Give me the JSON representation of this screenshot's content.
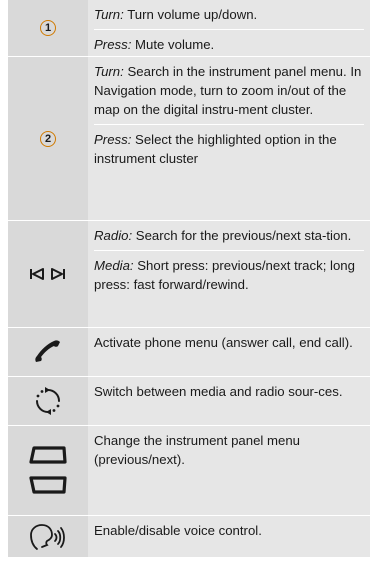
{
  "rows": [
    {
      "icon": "number-1-circle-icon",
      "badge": "1",
      "paras": [
        {
          "label": "Turn:",
          "text": " Turn volume up/down."
        },
        {
          "label": "Press:",
          "text": " Mute volume."
        }
      ]
    },
    {
      "icon": "number-2-circle-icon",
      "badge": "2",
      "paras": [
        {
          "label": "Turn:",
          "text": " Search in the instrument panel menu. In Navigation mode, turn to zoom in/out of the map on the digital instru-ment cluster."
        },
        {
          "label": "Press:",
          "text": " Select the highlighted option in the instrument cluster"
        }
      ]
    },
    {
      "icon": "previous-next-icon",
      "paras": [
        {
          "label": "Radio:",
          "text": " Search for the previous/next sta-tion."
        },
        {
          "label": "Media:",
          "text": " Short press: previous/next track; long press: fast forward/rewind."
        }
      ]
    },
    {
      "icon": "phone-icon",
      "paras": [
        {
          "label": "",
          "text": "Activate phone menu (answer call, end call)."
        }
      ]
    },
    {
      "icon": "source-switch-icon",
      "paras": [
        {
          "label": "",
          "text": "Switch between media and radio sour-ces."
        }
      ]
    },
    {
      "icon": "instrument-menu-icon",
      "paras": [
        {
          "label": "",
          "text": "Change the instrument panel menu (previous/next)."
        }
      ]
    },
    {
      "icon": "voice-control-icon",
      "paras": [
        {
          "label": "",
          "text": "Enable/disable voice control."
        }
      ]
    }
  ],
  "colors": {
    "icon_cell": "#d9d9d9",
    "text_cell": "#e6e6e6",
    "badge_ring": "#d07a00"
  }
}
